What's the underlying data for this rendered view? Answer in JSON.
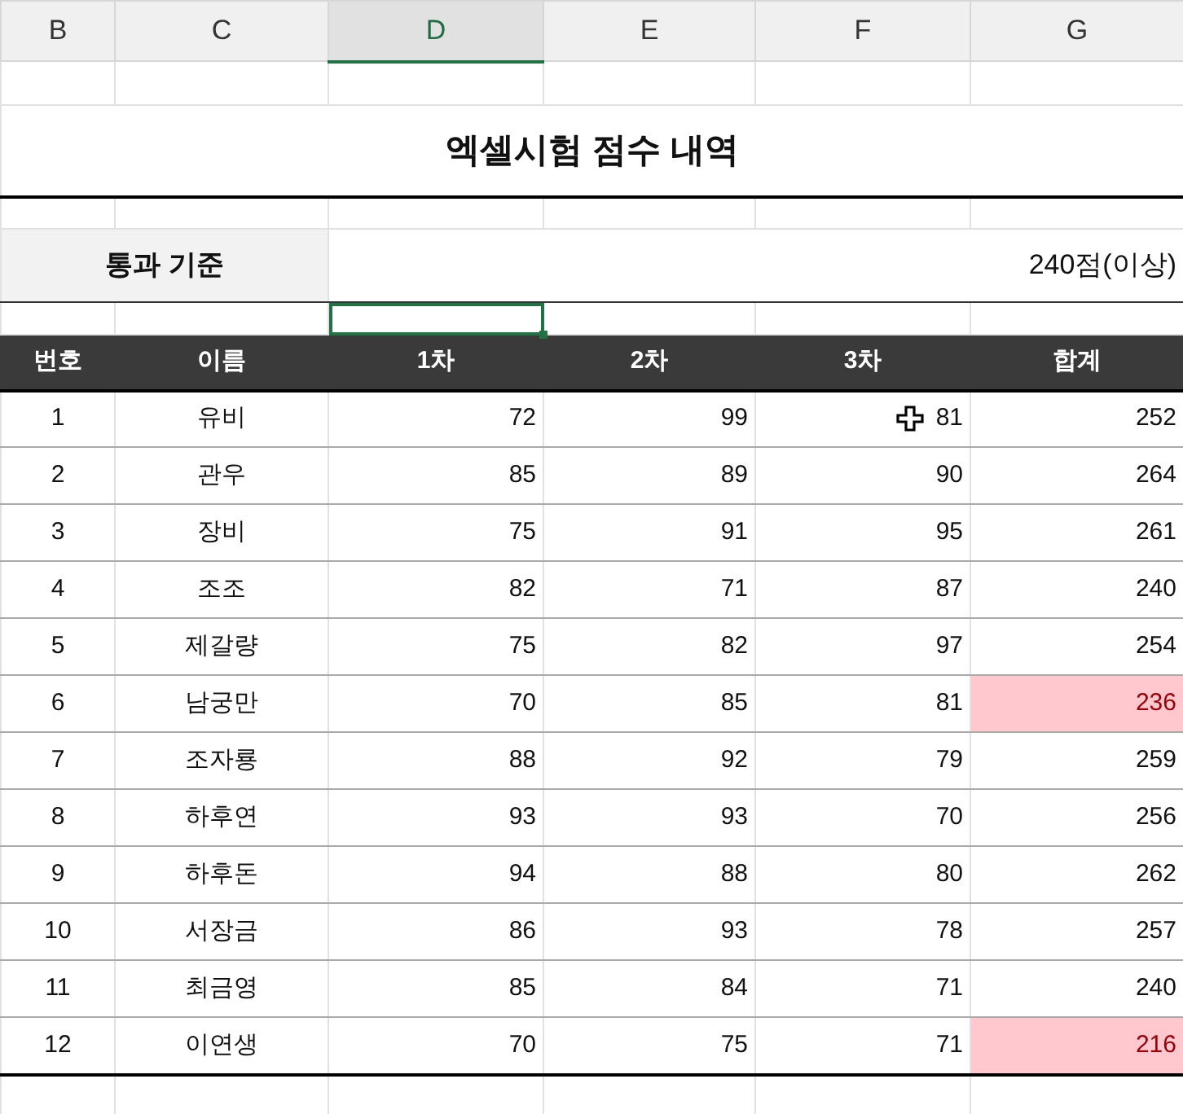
{
  "column_headers": [
    {
      "label": "B",
      "selected": false
    },
    {
      "label": "C",
      "selected": false
    },
    {
      "label": "D",
      "selected": true
    },
    {
      "label": "E",
      "selected": false
    },
    {
      "label": "F",
      "selected": false
    },
    {
      "label": "G",
      "selected": false
    }
  ],
  "title": "엑셀시험 점수 내역",
  "criteria": {
    "label": "통과 기준",
    "value": "240점(이상)"
  },
  "table": {
    "columns": [
      "번호",
      "이름",
      "1차",
      "2차",
      "3차",
      "합계"
    ],
    "rows": [
      {
        "cells": [
          "1",
          "유비",
          "72",
          "99",
          "81",
          "252"
        ],
        "highlighted": false
      },
      {
        "cells": [
          "2",
          "관우",
          "85",
          "89",
          "90",
          "264"
        ],
        "highlighted": false
      },
      {
        "cells": [
          "3",
          "장비",
          "75",
          "91",
          "95",
          "261"
        ],
        "highlighted": false
      },
      {
        "cells": [
          "4",
          "조조",
          "82",
          "71",
          "87",
          "240"
        ],
        "highlighted": false
      },
      {
        "cells": [
          "5",
          "제갈량",
          "75",
          "82",
          "97",
          "254"
        ],
        "highlighted": false
      },
      {
        "cells": [
          "6",
          "남궁만",
          "70",
          "85",
          "81",
          "236"
        ],
        "highlighted": true
      },
      {
        "cells": [
          "7",
          "조자룡",
          "88",
          "92",
          "79",
          "259"
        ],
        "highlighted": false
      },
      {
        "cells": [
          "8",
          "하후연",
          "93",
          "93",
          "70",
          "256"
        ],
        "highlighted": false
      },
      {
        "cells": [
          "9",
          "하후돈",
          "94",
          "88",
          "80",
          "262"
        ],
        "highlighted": false
      },
      {
        "cells": [
          "10",
          "서장금",
          "86",
          "93",
          "78",
          "257"
        ],
        "highlighted": false
      },
      {
        "cells": [
          "11",
          "최금영",
          "85",
          "84",
          "71",
          "240"
        ],
        "highlighted": false
      },
      {
        "cells": [
          "12",
          "이연생",
          "70",
          "75",
          "71",
          "216"
        ],
        "highlighted": true
      }
    ]
  }
}
